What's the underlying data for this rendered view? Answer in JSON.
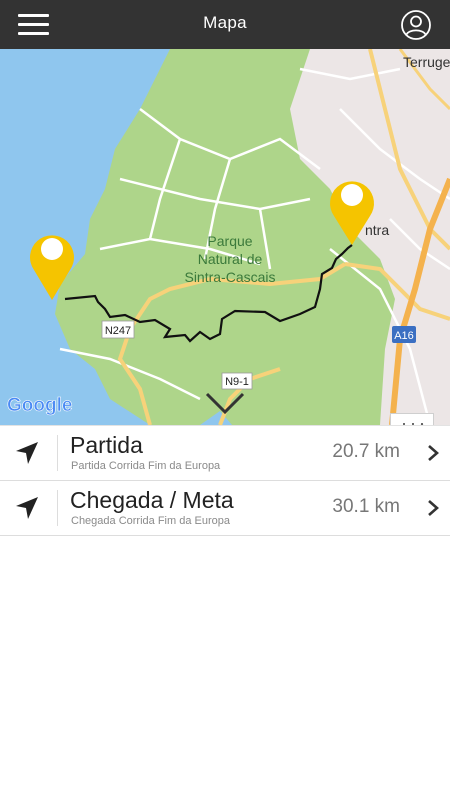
{
  "header": {
    "title": "Mapa",
    "menu_icon": "hamburger-menu-icon",
    "profile_icon": "user-profile-icon"
  },
  "map": {
    "labels": {
      "park_line1": "Parque",
      "park_line2": "Natural de",
      "park_line3": "Sintra-Cascais",
      "town_top": "Terruge",
      "town_sintra": "ntra",
      "road_n247": "N247",
      "road_n9": "N9-1",
      "road_a16": "A16",
      "google": "Google"
    },
    "colors": {
      "sea": "#8fc6ee",
      "land": "#aed58a",
      "urban": "#ece6e6",
      "route": "#111111",
      "pin": "#f5c400"
    },
    "filter_icon": "filter-sliders-icon",
    "collapse_icon": "chevron-down-icon"
  },
  "list": {
    "items": [
      {
        "title": "Partida",
        "subtitle": "Partida Corrida Fim da Europa",
        "distance": "20.7 km"
      },
      {
        "title": "Chegada / Meta",
        "subtitle": "Chegada Corrida Fim da Europa",
        "distance": "30.1 km"
      }
    ]
  }
}
